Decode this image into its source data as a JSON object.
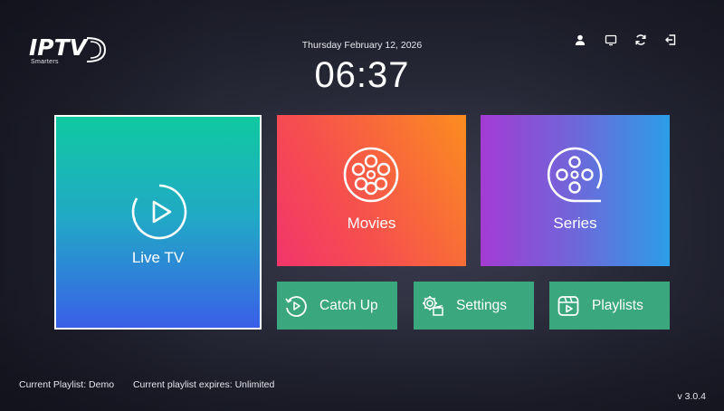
{
  "logo": {
    "text": "IPTV",
    "subtext": "Smarters"
  },
  "header": {
    "date": "Thursday February 12, 2026",
    "time": "06:37",
    "icons": [
      {
        "name": "user-icon"
      },
      {
        "name": "cast-icon"
      },
      {
        "name": "refresh-icon"
      },
      {
        "name": "logout-icon"
      }
    ]
  },
  "tiles": {
    "live_tv": {
      "label": "Live TV",
      "icon": "play-circle-icon"
    },
    "movies": {
      "label": "Movies",
      "icon": "film-reel-icon"
    },
    "series": {
      "label": "Series",
      "icon": "film-reel-icon"
    }
  },
  "buttons": {
    "catch_up": {
      "label": "Catch Up",
      "icon": "history-icon"
    },
    "settings": {
      "label": "Settings",
      "icon": "gear-icon"
    },
    "playlists": {
      "label": "Playlists",
      "icon": "playlist-icon"
    }
  },
  "footer": {
    "playlist": "Current Playlist: Demo",
    "expires": "Current playlist expires: Unlimited",
    "version": "v 3.0.4"
  },
  "colors": {
    "live_tv_gradient": [
      "#0fc9a0",
      "#3a5fe8"
    ],
    "movies_gradient": [
      "#f2356b",
      "#fb8d1f"
    ],
    "series_gradient": [
      "#a33bd2",
      "#2b9ee8"
    ],
    "button_green": "#3aa77f"
  }
}
